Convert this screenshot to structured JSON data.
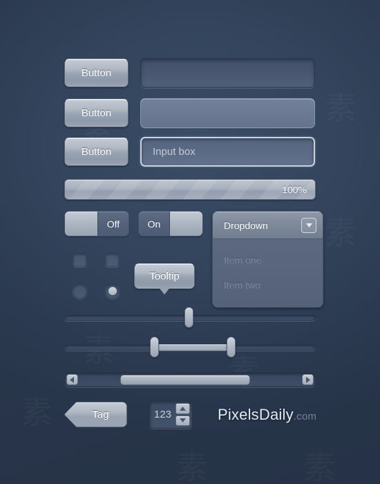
{
  "theme": {
    "background": "#2c3c53",
    "control_light": "#b2bac6",
    "control_dark": "#44546d",
    "text_primary": "#ffffff",
    "text_muted": "#7c899e",
    "brand_color": "#e2e8f0",
    "tld_color": "#768299"
  },
  "buttons": [
    {
      "label": "Button"
    },
    {
      "label": "Button"
    },
    {
      "label": "Button"
    }
  ],
  "fields": [
    {
      "value": "",
      "placeholder": "",
      "style": "dark"
    },
    {
      "value": "",
      "placeholder": "",
      "style": "light"
    },
    {
      "value": "Input box",
      "placeholder": "Input box",
      "style": "focused"
    }
  ],
  "progress": {
    "label": "100%",
    "value": 100,
    "max": 100
  },
  "toggles": [
    {
      "label": "Off",
      "state": "off",
      "knob_side": "left"
    },
    {
      "label": "On",
      "state": "on",
      "knob_side": "right"
    }
  ],
  "dropdown": {
    "selected": "Dropdown",
    "arrow_icon": "chevron-down-icon",
    "items": [
      {
        "label": "Item one"
      },
      {
        "label": "Item two"
      }
    ]
  },
  "checkboxes": [
    {
      "checked": false
    },
    {
      "checked": false
    }
  ],
  "radios": [
    {
      "checked": false
    },
    {
      "checked": true
    }
  ],
  "tooltip": {
    "label": "Tooltip"
  },
  "sliders": {
    "single": {
      "value": 50
    },
    "range": {
      "low": 36,
      "high": 66
    }
  },
  "scrollbar": {
    "left_arrow_icon": "arrow-left-icon",
    "right_arrow_icon": "arrow-right-icon",
    "thumb_start": 24,
    "thumb_end": 74
  },
  "tag": {
    "label": "Tag"
  },
  "stepper": {
    "value": "123",
    "up_icon": "arrow-up-icon",
    "down_icon": "arrow-down-icon"
  },
  "brand": {
    "name": "PixelsDaily",
    "tld": ".com"
  }
}
